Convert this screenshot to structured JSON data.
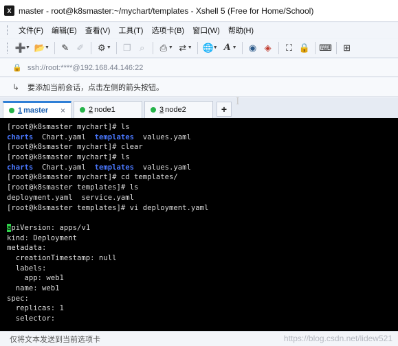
{
  "window": {
    "icon_text": "X",
    "title": "master - root@k8smaster:~/mychart/templates - Xshell 5 (Free for Home/School)"
  },
  "menu": [
    "文件(F)",
    "编辑(E)",
    "查看(V)",
    "工具(T)",
    "选项卡(B)",
    "窗口(W)",
    "帮助(H)"
  ],
  "toolbar": {
    "icons": [
      "new-session-icon",
      "open-folder-icon",
      "pencil-icon",
      "eraser-icon",
      "properties-icon",
      "copy-icon",
      "find-icon",
      "print-icon",
      "transfer-icon",
      "globe-icon",
      "font-icon",
      "xftp-icon",
      "xshell-icon",
      "fullscreen-icon",
      "lock-icon",
      "keyboard-icon",
      "add-icon"
    ]
  },
  "address": {
    "text": "ssh://root:****@192.168.44.146:22"
  },
  "hint": {
    "text": "要添加当前会话，点击左侧的箭头按钮。"
  },
  "tabs": [
    {
      "num": "1",
      "label": "master",
      "active": true,
      "close": "×"
    },
    {
      "num": "2",
      "label": "node1",
      "active": false
    },
    {
      "num": "3",
      "label": "node2",
      "active": false
    }
  ],
  "tab_add": "+",
  "terminal": {
    "lines": [
      [
        {
          "t": "[root@k8smaster mychart]# ls",
          "c": ""
        }
      ],
      [
        {
          "t": "charts",
          "c": "blue"
        },
        {
          "t": "  Chart.yaml  ",
          "c": ""
        },
        {
          "t": "templates",
          "c": "blue"
        },
        {
          "t": "  values.yaml",
          "c": ""
        }
      ],
      [
        {
          "t": "[root@k8smaster mychart]# clear",
          "c": ""
        }
      ],
      [
        {
          "t": "[root@k8smaster mychart]# ls",
          "c": ""
        }
      ],
      [
        {
          "t": "charts",
          "c": "blue"
        },
        {
          "t": "  Chart.yaml  ",
          "c": ""
        },
        {
          "t": "templates",
          "c": "blue"
        },
        {
          "t": "  values.yaml",
          "c": ""
        }
      ],
      [
        {
          "t": "[root@k8smaster mychart]# cd templates/",
          "c": ""
        }
      ],
      [
        {
          "t": "[root@k8smaster templates]# ls",
          "c": ""
        }
      ],
      [
        {
          "t": "deployment.yaml  service.yaml",
          "c": ""
        }
      ],
      [
        {
          "t": "[root@k8smaster templates]# vi deployment.yaml",
          "c": ""
        }
      ],
      [],
      [
        {
          "t": "a",
          "c": "cursor-block"
        },
        {
          "t": "piVersion: apps/v1",
          "c": ""
        }
      ],
      [
        {
          "t": "kind: Deployment",
          "c": ""
        }
      ],
      [
        {
          "t": "metadata:",
          "c": ""
        }
      ],
      [
        {
          "t": "  creationTimestamp: null",
          "c": ""
        }
      ],
      [
        {
          "t": "  labels:",
          "c": ""
        }
      ],
      [
        {
          "t": "    app: web1",
          "c": ""
        }
      ],
      [
        {
          "t": "  name: web1",
          "c": ""
        }
      ],
      [
        {
          "t": "spec:",
          "c": ""
        }
      ],
      [
        {
          "t": "  replicas: 1",
          "c": ""
        }
      ],
      [
        {
          "t": "  selector:",
          "c": ""
        }
      ]
    ]
  },
  "status": {
    "text": "仅将文本发送到当前选项卡"
  },
  "watermark": "https://blog.csdn.net/lidew521",
  "colors": {
    "accent": "#2f7fd6",
    "terminal_bg": "#000000",
    "terminal_fg": "#dcdcdc",
    "dir_blue": "#4a78ff",
    "cursor_green": "#2fd24a",
    "session_dot": "#26b34a"
  }
}
